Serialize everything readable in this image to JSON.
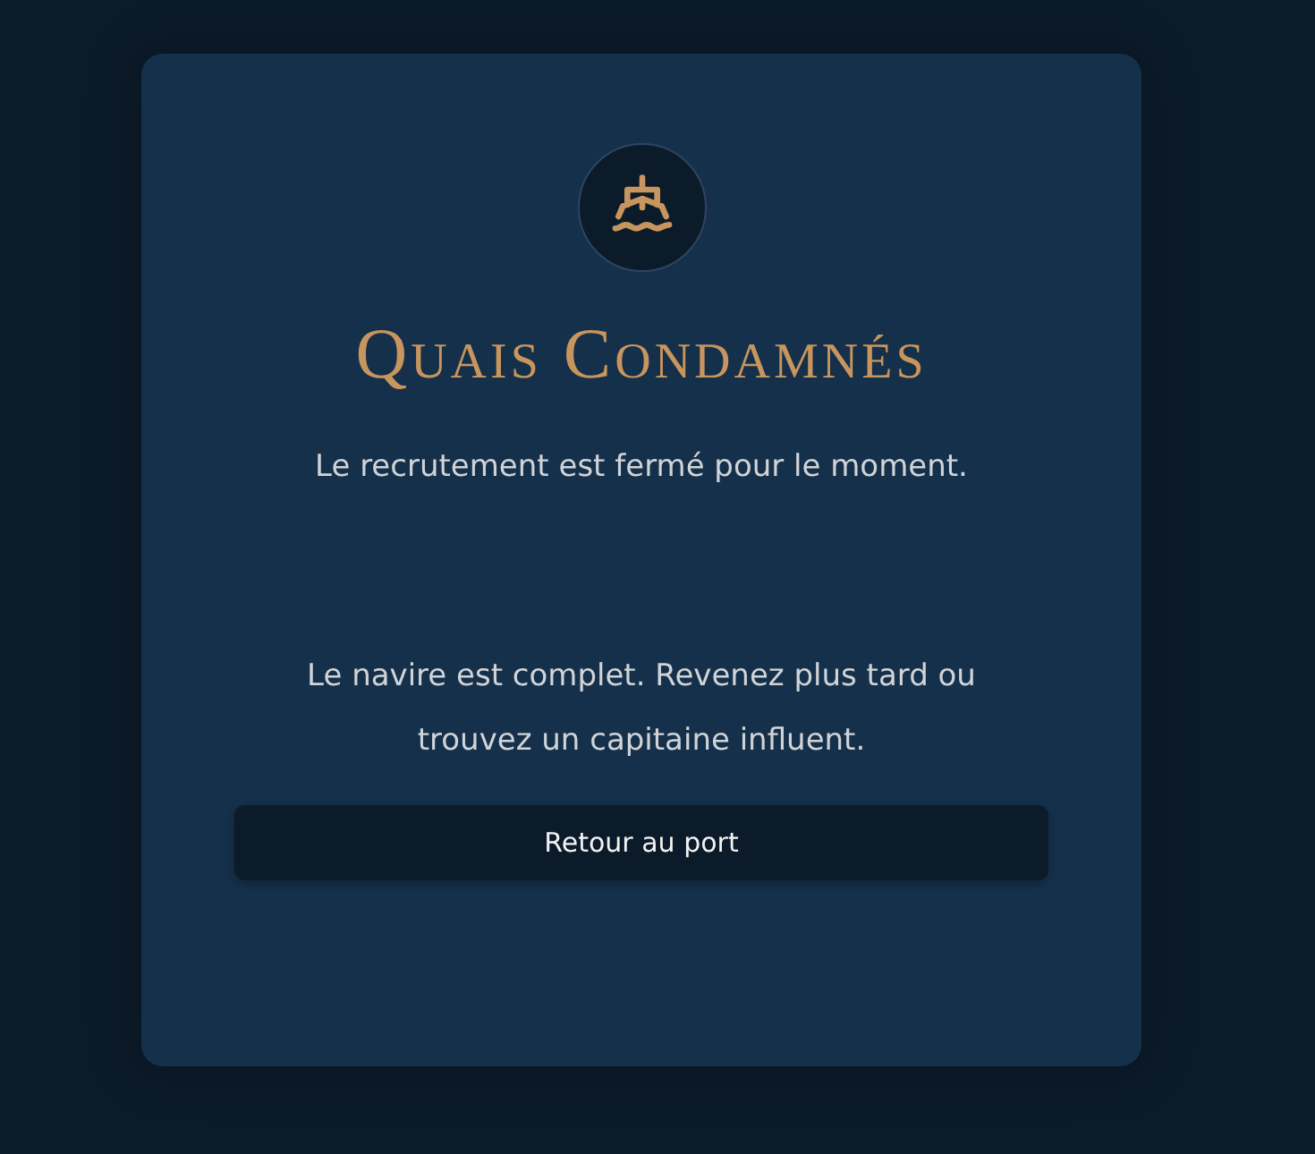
{
  "card": {
    "title": "Quais Condamnés",
    "subtitle": "Le recrutement est fermé pour le moment.",
    "message": "Le navire est complet. Revenez plus tard ou trouvez un capitaine influent.",
    "button": "Retour au port"
  }
}
